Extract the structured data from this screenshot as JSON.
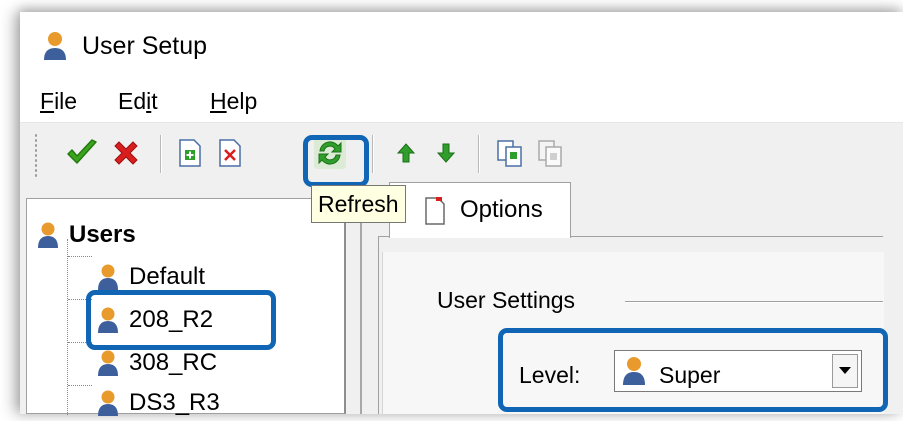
{
  "window": {
    "title": "User Setup"
  },
  "menu": {
    "file": {
      "mnemonic": "F",
      "rest": "ile"
    },
    "edit": {
      "pre": "Ed",
      "mnemonic": "i",
      "rest": "t"
    },
    "help": {
      "mnemonic": "H",
      "rest": "elp"
    }
  },
  "toolbar": {
    "buttons": [
      "accept-icon",
      "cancel-icon",
      "new-item-icon",
      "delete-item-icon",
      "refresh-icon",
      "move-up-icon",
      "move-down-icon",
      "copy-icon",
      "paste-icon"
    ],
    "tooltip": "Refresh"
  },
  "tree": {
    "root": "Users",
    "items": [
      "Default",
      "208_R2",
      "308_RC",
      "DS3_R3"
    ]
  },
  "tabs": {
    "options": "Options"
  },
  "settings": {
    "group_label": "User Settings",
    "level_label": "Level:",
    "level_value": "Super"
  },
  "colors": {
    "highlight": "#1066b4",
    "accept_green": "#3aa51c",
    "cancel_red": "#d91e1e",
    "refresh_green": "#2f9e2a",
    "user_orange": "#e89a2c",
    "user_blue": "#3d5f9b",
    "tooltip_bg": "#ffffe1"
  }
}
